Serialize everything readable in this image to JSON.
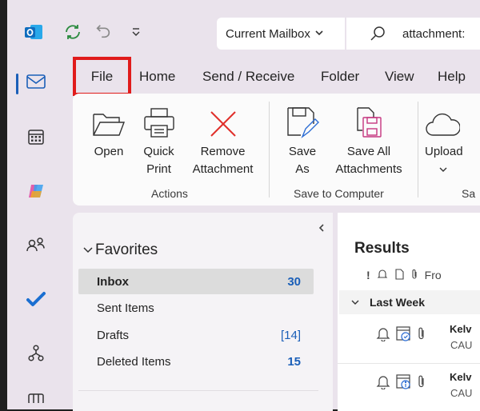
{
  "colors": {
    "accent": "#1b5fb8",
    "highlight_box": "#e01b1b",
    "rail_bg": "#eae3ec"
  },
  "titlebar": {
    "mailbox_label": "Current Mailbox",
    "search_value": "attachment:"
  },
  "rail": {
    "items": [
      "mail-icon",
      "calendar-icon",
      "copilot-icon",
      "people-icon",
      "todo-icon",
      "org-explorer-icon",
      "apps-icon"
    ]
  },
  "tabs": [
    "File",
    "Home",
    "Send / Receive",
    "Folder",
    "View",
    "Help"
  ],
  "ribbon": {
    "open": "Open",
    "quick_print": [
      "Quick",
      "Print"
    ],
    "remove_attachment": [
      "Remove",
      "Attachment"
    ],
    "save_as": [
      "Save",
      "As"
    ],
    "save_all": [
      "Save All",
      "Attachments"
    ],
    "upload": "Upload",
    "group_actions": "Actions",
    "group_save": "Save to Computer",
    "group_share_partial": "Sa"
  },
  "folders": {
    "header": "Favorites",
    "items": [
      {
        "name": "Inbox",
        "count": "30"
      },
      {
        "name": "Sent Items",
        "count": ""
      },
      {
        "name": "Drafts",
        "count": "[14]"
      },
      {
        "name": "Deleted Items",
        "count": "15"
      }
    ]
  },
  "results": {
    "title": "Results",
    "col_from": "Fro",
    "group": "Last Week",
    "messages": [
      {
        "sender": "Kelv",
        "subject": "CAU"
      },
      {
        "sender": "Kelv",
        "subject": "CAU"
      }
    ]
  }
}
